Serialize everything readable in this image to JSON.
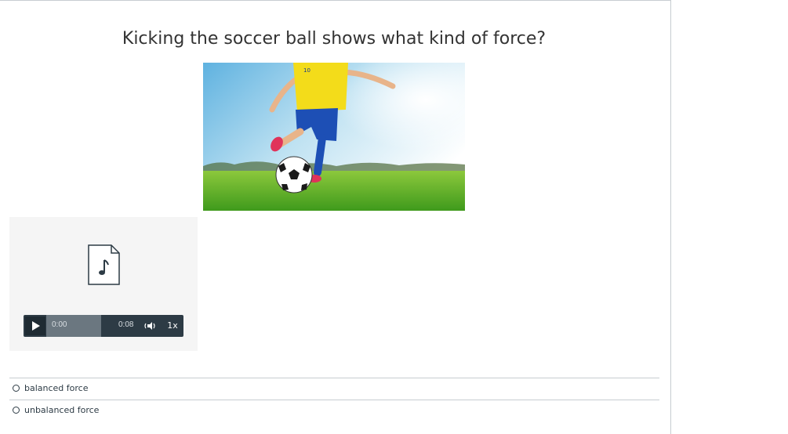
{
  "question": {
    "title": "Kicking the soccer ball shows what kind of force?"
  },
  "photo": {
    "jersey_number": "10"
  },
  "audio": {
    "current_time": "0:00",
    "total_time": "0:08",
    "speed": "1x",
    "progress": 0.0
  },
  "answers": [
    {
      "label": "balanced force",
      "selected": false
    },
    {
      "label": "unbalanced force",
      "selected": false
    }
  ],
  "colors": {
    "player_bg": "#2d3b45",
    "card_bg": "#f5f5f5",
    "divider": "#c7cdd1"
  }
}
